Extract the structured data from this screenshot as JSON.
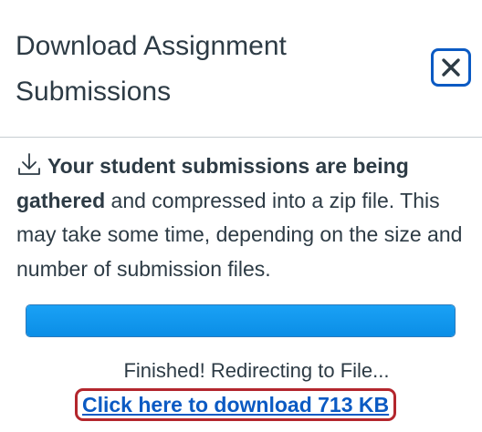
{
  "dialog": {
    "title": "Download Assignment Submissions",
    "close_icon": "close-icon"
  },
  "message": {
    "icon": "download-icon",
    "bold_text": "Your student submissions are being gathered",
    "rest_text": " and compressed into a zip file. This may take some time, depending on the size and number of submission files."
  },
  "progress": {
    "fraction": 1.0,
    "fill_color": "#1aa1f5"
  },
  "status": {
    "text": "Finished! Redirecting to File..."
  },
  "download": {
    "link_text": "Click here to download 713 KB",
    "link_color": "#0b5ac3",
    "focus_ring_color": "#b3262d"
  }
}
